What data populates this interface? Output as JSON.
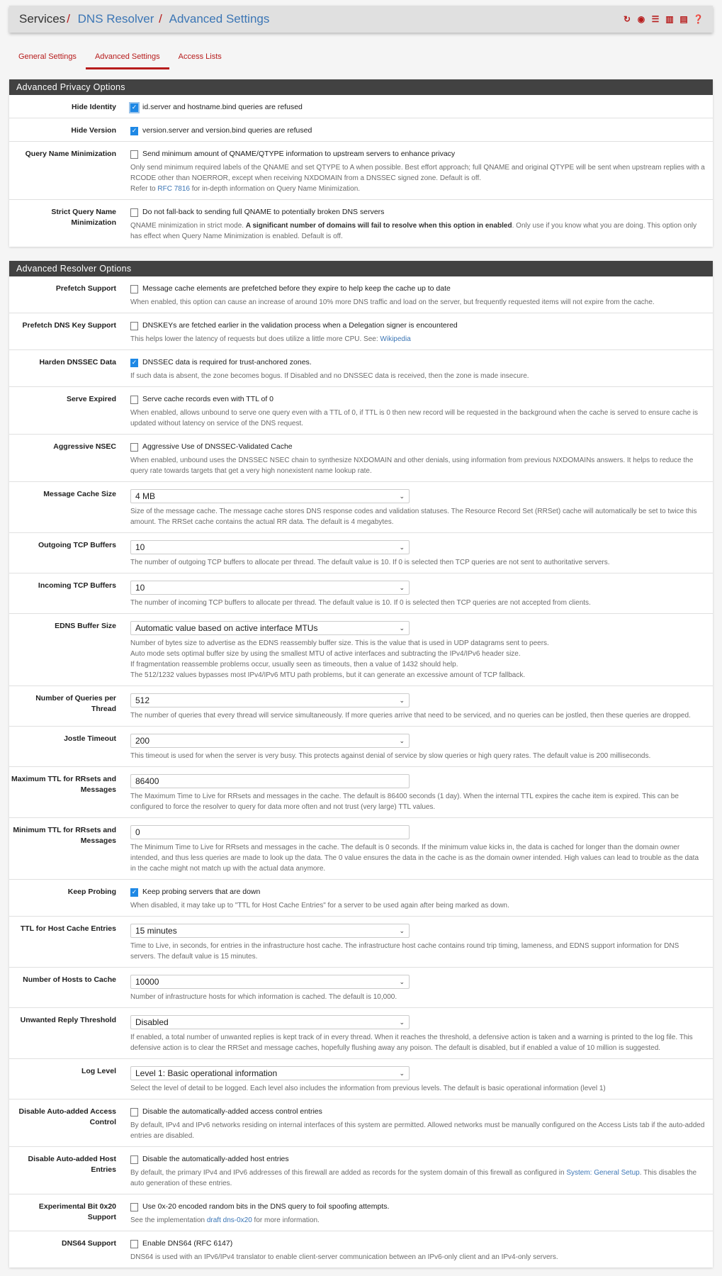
{
  "breadcrumb": {
    "root": "Services",
    "level2": "DNS Resolver",
    "level3": "Advanced Settings"
  },
  "header_icons": [
    "restart-icon",
    "stop-icon",
    "settings-sliders-icon",
    "chart-icon",
    "log-icon",
    "help-icon"
  ],
  "tabs": [
    {
      "label": "General Settings",
      "active": false
    },
    {
      "label": "Advanced Settings",
      "active": true
    },
    {
      "label": "Access Lists",
      "active": false
    }
  ],
  "colors": {
    "accent": "#b71c1c",
    "link": "#3c76b5",
    "panel_header": "#424242",
    "checkbox": "#1e88e5"
  },
  "privacy": {
    "title": "Advanced Privacy Options",
    "hide_identity": {
      "label": "Hide Identity",
      "text": "id.server and hostname.bind queries are refused",
      "checked": true
    },
    "hide_version": {
      "label": "Hide Version",
      "text": "version.server and version.bind queries are refused",
      "checked": true
    },
    "qname_min": {
      "label": "Query Name Minimization",
      "text": "Send minimum amount of QNAME/QTYPE information to upstream servers to enhance privacy",
      "checked": false,
      "help1": "Only send minimum required labels of the QNAME and set QTYPE to A when possible. Best effort approach; full QNAME and original QTYPE will be sent when upstream replies with a RCODE other than NOERROR, except when receiving NXDOMAIN from a DNSSEC signed zone. Default is off.",
      "help2_pre": "Refer to ",
      "help2_link": "RFC 7816",
      "help2_post": " for in-depth information on Query Name Minimization."
    },
    "strict_qname": {
      "label": "Strict Query Name Minimization",
      "text": "Do not fall-back to sending full QNAME to potentially broken DNS servers",
      "checked": false,
      "help_pre": "QNAME minimization in strict mode. ",
      "help_bold": "A significant number of domains will fail to resolve when this option in enabled",
      "help_post": ". Only use if you know what you are doing. This option only has effect when Query Name Minimization is enabled. Default is off."
    }
  },
  "resolver": {
    "title": "Advanced Resolver Options",
    "prefetch": {
      "label": "Prefetch Support",
      "text": "Message cache elements are prefetched before they expire to help keep the cache up to date",
      "checked": false,
      "help": "When enabled, this option can cause an increase of around 10% more DNS traffic and load on the server, but frequently requested items will not expire from the cache."
    },
    "prefetch_key": {
      "label": "Prefetch DNS Key Support",
      "text": "DNSKEYs are fetched earlier in the validation process when a Delegation signer is encountered",
      "checked": false,
      "help_pre": "This helps lower the latency of requests but does utilize a little more CPU. See: ",
      "help_link": "Wikipedia"
    },
    "harden": {
      "label": "Harden DNSSEC Data",
      "text": "DNSSEC data is required for trust-anchored zones.",
      "checked": true,
      "help": "If such data is absent, the zone becomes bogus. If Disabled and no DNSSEC data is received, then the zone is made insecure."
    },
    "serve_expired": {
      "label": "Serve Expired",
      "text": "Serve cache records even with TTL of 0",
      "checked": false,
      "help": "When enabled, allows unbound to serve one query even with a TTL of 0, if TTL is 0 then new record will be requested in the background when the cache is served to ensure cache is updated without latency on service of the DNS request."
    },
    "aggr_nsec": {
      "label": "Aggressive NSEC",
      "text": "Aggressive Use of DNSSEC-Validated Cache",
      "checked": false,
      "help": "When enabled, unbound uses the DNSSEC NSEC chain to synthesize NXDOMAIN and other denials, using information from previous NXDOMAINs answers. It helps to reduce the query rate towards targets that get a very high nonexistent name lookup rate."
    },
    "msg_cache": {
      "label": "Message Cache Size",
      "value": "4 MB",
      "help": "Size of the message cache. The message cache stores DNS response codes and validation statuses. The Resource Record Set (RRSet) cache will automatically be set to twice this amount. The RRSet cache contains the actual RR data. The default is 4 megabytes."
    },
    "out_tcp": {
      "label": "Outgoing TCP Buffers",
      "value": "10",
      "help": "The number of outgoing TCP buffers to allocate per thread. The default value is 10. If 0 is selected then TCP queries are not sent to authoritative servers."
    },
    "in_tcp": {
      "label": "Incoming TCP Buffers",
      "value": "10",
      "help": "The number of incoming TCP buffers to allocate per thread. The default value is 10. If 0 is selected then TCP queries are not accepted from clients."
    },
    "edns": {
      "label": "EDNS Buffer Size",
      "value": "Automatic value based on active interface MTUs",
      "help1": "Number of bytes size to advertise as the EDNS reassembly buffer size. This is the value that is used in UDP datagrams sent to peers.",
      "help2": "Auto mode sets optimal buffer size by using the smallest MTU of active interfaces and subtracting the IPv4/IPv6 header size.",
      "help3": "If fragmentation reassemble problems occur, usually seen as timeouts, then a value of 1432 should help.",
      "help4": "The 512/1232 values bypasses most IPv4/IPv6 MTU path problems, but it can generate an excessive amount of TCP fallback."
    },
    "queries": {
      "label": "Number of Queries per Thread",
      "value": "512",
      "help": "The number of queries that every thread will service simultaneously. If more queries arrive that need to be serviced, and no queries can be jostled, then these queries are dropped."
    },
    "jostle": {
      "label": "Jostle Timeout",
      "value": "200",
      "help": "This timeout is used for when the server is very busy. This protects against denial of service by slow queries or high query rates. The default value is 200 milliseconds."
    },
    "max_ttl": {
      "label": "Maximum TTL for RRsets and Messages",
      "value": "86400",
      "help": "The Maximum Time to Live for RRsets and messages in the cache. The default is 86400 seconds (1 day). When the internal TTL expires the cache item is expired. This can be configured to force the resolver to query for data more often and not trust (very large) TTL values."
    },
    "min_ttl": {
      "label": "Minimum TTL for RRsets and Messages",
      "value": "0",
      "help": "The Minimum Time to Live for RRsets and messages in the cache. The default is 0 seconds. If the minimum value kicks in, the data is cached for longer than the domain owner intended, and thus less queries are made to look up the data. The 0 value ensures the data in the cache is as the domain owner intended. High values can lead to trouble as the data in the cache might not match up with the actual data anymore."
    },
    "keep_probing": {
      "label": "Keep Probing",
      "text": "Keep probing servers that are down",
      "checked": true,
      "help": "When disabled, it may take up to \"TTL for Host Cache Entries\" for a server to be used again after being marked as down."
    },
    "host_ttl": {
      "label": "TTL for Host Cache Entries",
      "value": "15 minutes",
      "help": "Time to Live, in seconds, for entries in the infrastructure host cache. The infrastructure host cache contains round trip timing, lameness, and EDNS support information for DNS servers. The default value is 15 minutes."
    },
    "num_hosts": {
      "label": "Number of Hosts to Cache",
      "value": "10000",
      "help": "Number of infrastructure hosts for which information is cached. The default is 10,000."
    },
    "unwanted": {
      "label": "Unwanted Reply Threshold",
      "value": "Disabled",
      "help": "If enabled, a total number of unwanted replies is kept track of in every thread. When it reaches the threshold, a defensive action is taken and a warning is printed to the log file. This defensive action is to clear the RRSet and message caches, hopefully flushing away any poison. The default is disabled, but if enabled a value of 10 million is suggested."
    },
    "log_level": {
      "label": "Log Level",
      "value": "Level 1: Basic operational information",
      "help": "Select the level of detail to be logged. Each level also includes the information from previous levels. The default is basic operational information (level 1)"
    },
    "dis_acl": {
      "label": "Disable Auto-added Access Control",
      "text": "Disable the automatically-added access control entries",
      "checked": false,
      "help": "By default, IPv4 and IPv6 networks residing on internal interfaces of this system are permitted. Allowed networks must be manually configured on the Access Lists tab if the auto-added entries are disabled."
    },
    "dis_host": {
      "label": "Disable Auto-added Host Entries",
      "text": "Disable the automatically-added host entries",
      "checked": false,
      "help_pre": "By default, the primary IPv4 and IPv6 addresses of this firewall are added as records for the system domain of this firewall as configured in ",
      "help_link": "System: General Setup",
      "help_post": ". This disables the auto generation of these entries."
    },
    "bit0x20": {
      "label": "Experimental Bit 0x20 Support",
      "text": "Use 0x-20 encoded random bits in the DNS query to foil spoofing attempts.",
      "checked": false,
      "help_pre": "See the implementation ",
      "help_link": "draft dns-0x20",
      "help_post": " for more information."
    },
    "dns64": {
      "label": "DNS64 Support",
      "text": "Enable DNS64 (RFC 6147)",
      "checked": false,
      "help": "DNS64 is used with an IPv6/IPv4 translator to enable client-server communication between an IPv6-only client and an IPv4-only servers."
    }
  }
}
